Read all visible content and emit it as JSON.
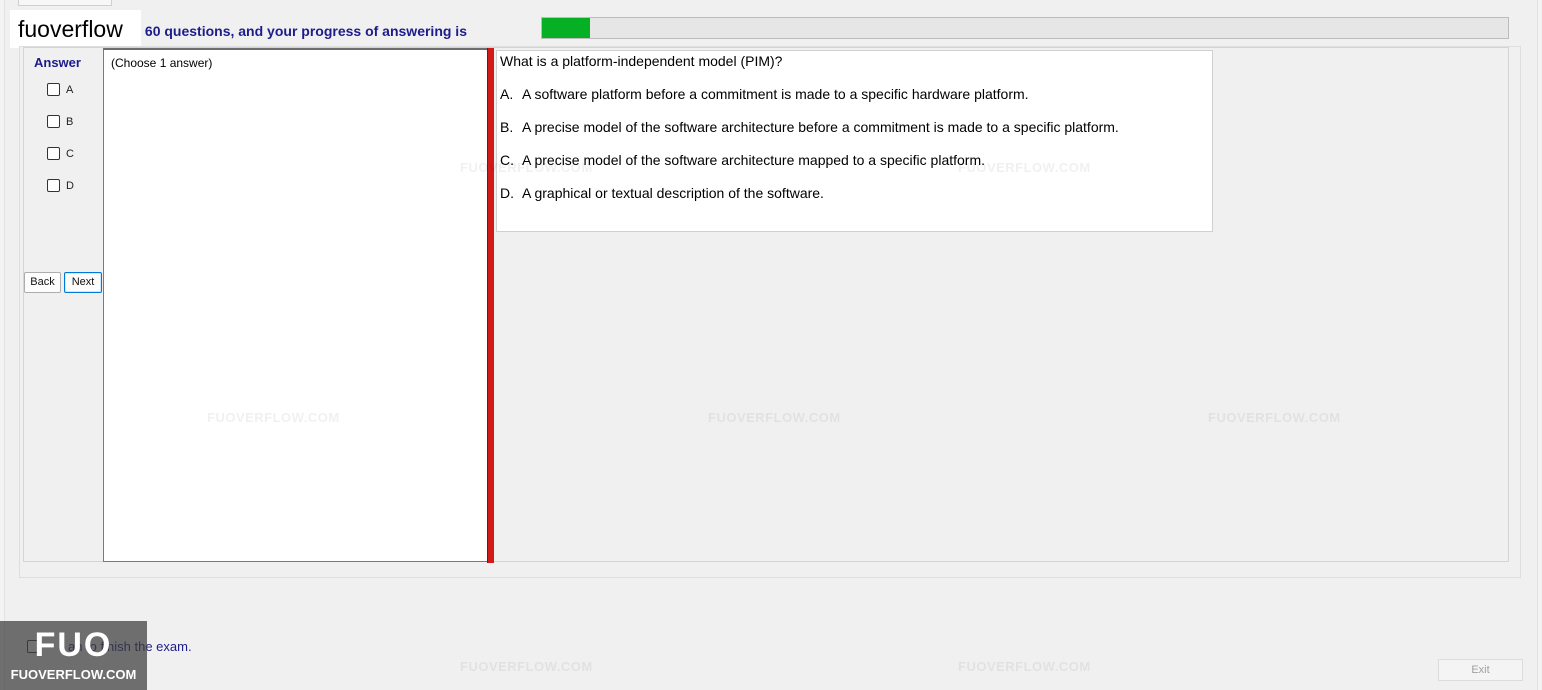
{
  "header": {
    "progress_text": "are 60 questions, and your progress of answering is",
    "progress_fraction": 0.05
  },
  "logo": {
    "text": "fuoverflow"
  },
  "answer_panel": {
    "title": "Answer",
    "options": [
      "A",
      "B",
      "C",
      "D"
    ],
    "back_label": "Back",
    "next_label": "Next",
    "hint": "(Choose 1 answer)"
  },
  "question": {
    "text": "What is a platform-independent model (PIM)?",
    "choices": [
      {
        "letter": "A.",
        "text": "A software platform before a commitment is made to a specific hardware platform."
      },
      {
        "letter": "B.",
        "text": "A precise model of the software architecture before a commitment is made to a specific platform."
      },
      {
        "letter": "C.",
        "text": "A precise model of the software architecture mapped to a specific platform."
      },
      {
        "letter": "D.",
        "text": "A graphical or textual description of the software."
      }
    ]
  },
  "watermark": {
    "text": "FUOVERFLOW.COM"
  },
  "footer": {
    "finish_label_prefix": "",
    "finish_label_visible": "an to finish the exam.",
    "overlay_big": "FUO",
    "overlay_small": "FUOVERFLOW.COM",
    "exit_label": "Exit"
  },
  "colors": {
    "accent_text": "#1c1c8c",
    "progress": "#06b025",
    "divider": "#d21a1a"
  }
}
